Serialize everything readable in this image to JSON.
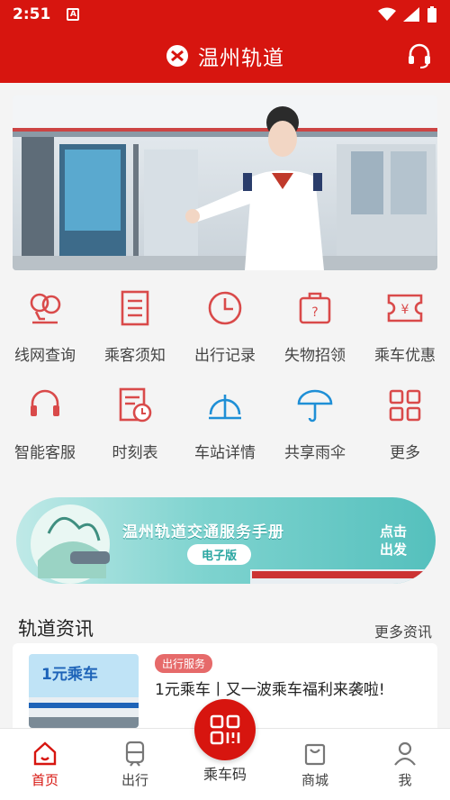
{
  "status_bar": {
    "time": "2:51",
    "notification_letter": "A"
  },
  "header": {
    "title": "温州轨道"
  },
  "grid": [
    [
      {
        "label": "线网查询",
        "icon": "map-balloon-icon"
      },
      {
        "label": "乘客须知",
        "icon": "notice-document-icon"
      },
      {
        "label": "出行记录",
        "icon": "clock-icon"
      },
      {
        "label": "失物招领",
        "icon": "lost-bag-icon"
      },
      {
        "label": "乘车优惠",
        "icon": "coupon-ticket-icon"
      }
    ],
    [
      {
        "label": "智能客服",
        "icon": "headset-icon"
      },
      {
        "label": "时刻表",
        "icon": "timetable-icon"
      },
      {
        "label": "车站详情",
        "icon": "station-icon"
      },
      {
        "label": "共享雨伞",
        "icon": "umbrella-icon"
      },
      {
        "label": "更多",
        "icon": "more-grid-icon"
      }
    ]
  ],
  "manual_banner": {
    "title": "温州轨道交通服务手册",
    "tag": "电子版",
    "cta_line1": "点击",
    "cta_line2": "出发"
  },
  "news": {
    "title": "轨道资讯",
    "more": "更多资讯",
    "items": [
      {
        "tag": "出行服务",
        "text": "1元乘车丨又一波乘车福利来袭啦!",
        "thumb_text": "1元乘车"
      }
    ]
  },
  "tabbar": {
    "items": [
      {
        "label": "首页",
        "icon": "home-icon",
        "active": true
      },
      {
        "label": "出行",
        "icon": "train-icon",
        "active": false
      },
      {
        "label": "乘车码",
        "icon": "qr-code-icon",
        "active": false
      },
      {
        "label": "商城",
        "icon": "shop-bag-icon",
        "active": false
      },
      {
        "label": "我",
        "icon": "user-icon",
        "active": false
      }
    ]
  },
  "colors": {
    "brand_red": "#d7150f",
    "icon_red": "#d94a4a",
    "icon_blue": "#1f8fd6",
    "teal": "#55c0bd"
  }
}
